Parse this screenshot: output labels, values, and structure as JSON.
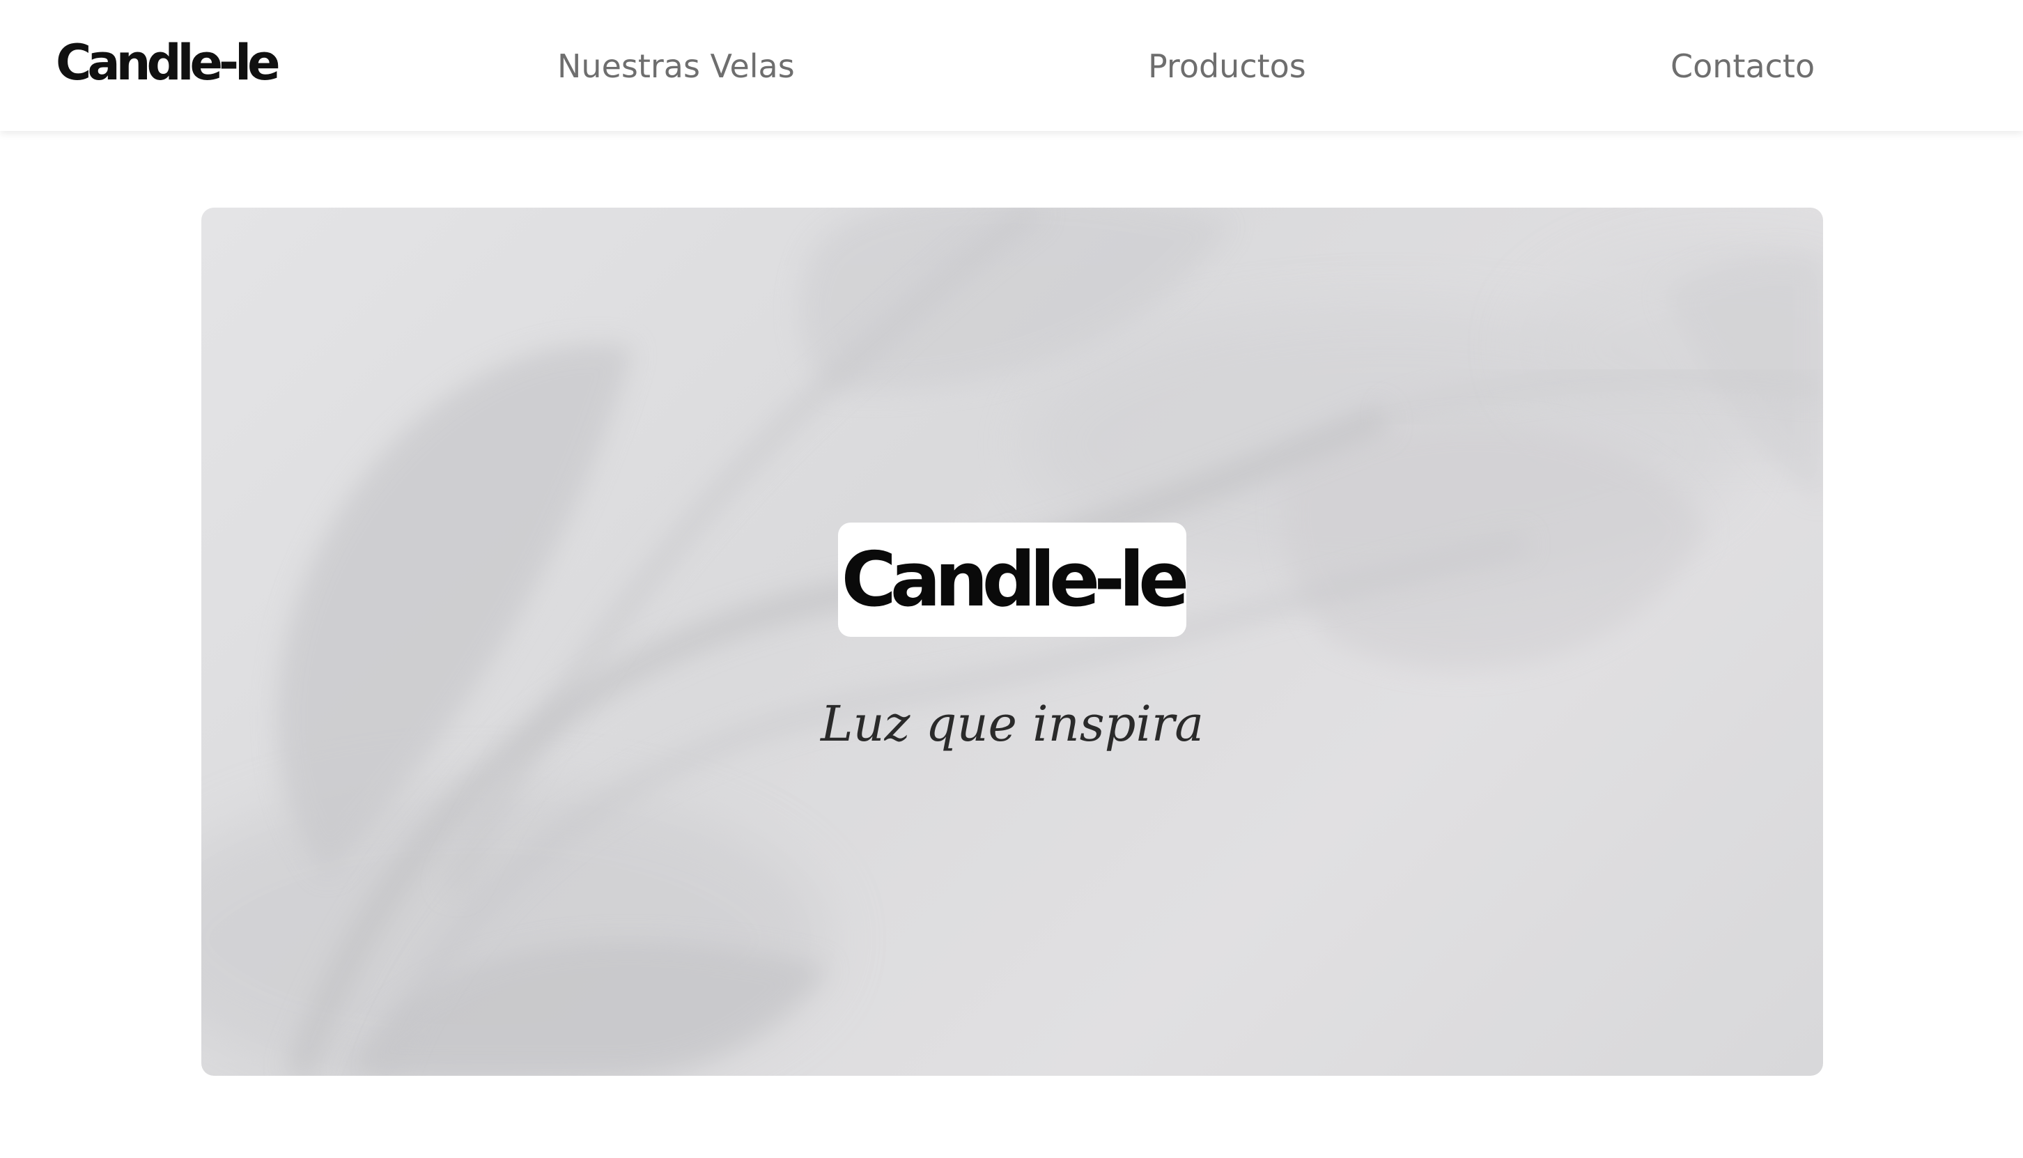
{
  "brand": {
    "name": "Candle-le"
  },
  "nav": {
    "links": [
      {
        "label": "Nuestras Velas"
      },
      {
        "label": "Productos"
      },
      {
        "label": "Contacto"
      }
    ]
  },
  "hero": {
    "logo_text": "Candle-le",
    "tagline": "Luz que inspira",
    "background": "leaf-shadow-photo"
  },
  "colors": {
    "nav_text": "#6e6e6e",
    "logo": "#111111",
    "hero_bg": "#e0e0e2"
  }
}
